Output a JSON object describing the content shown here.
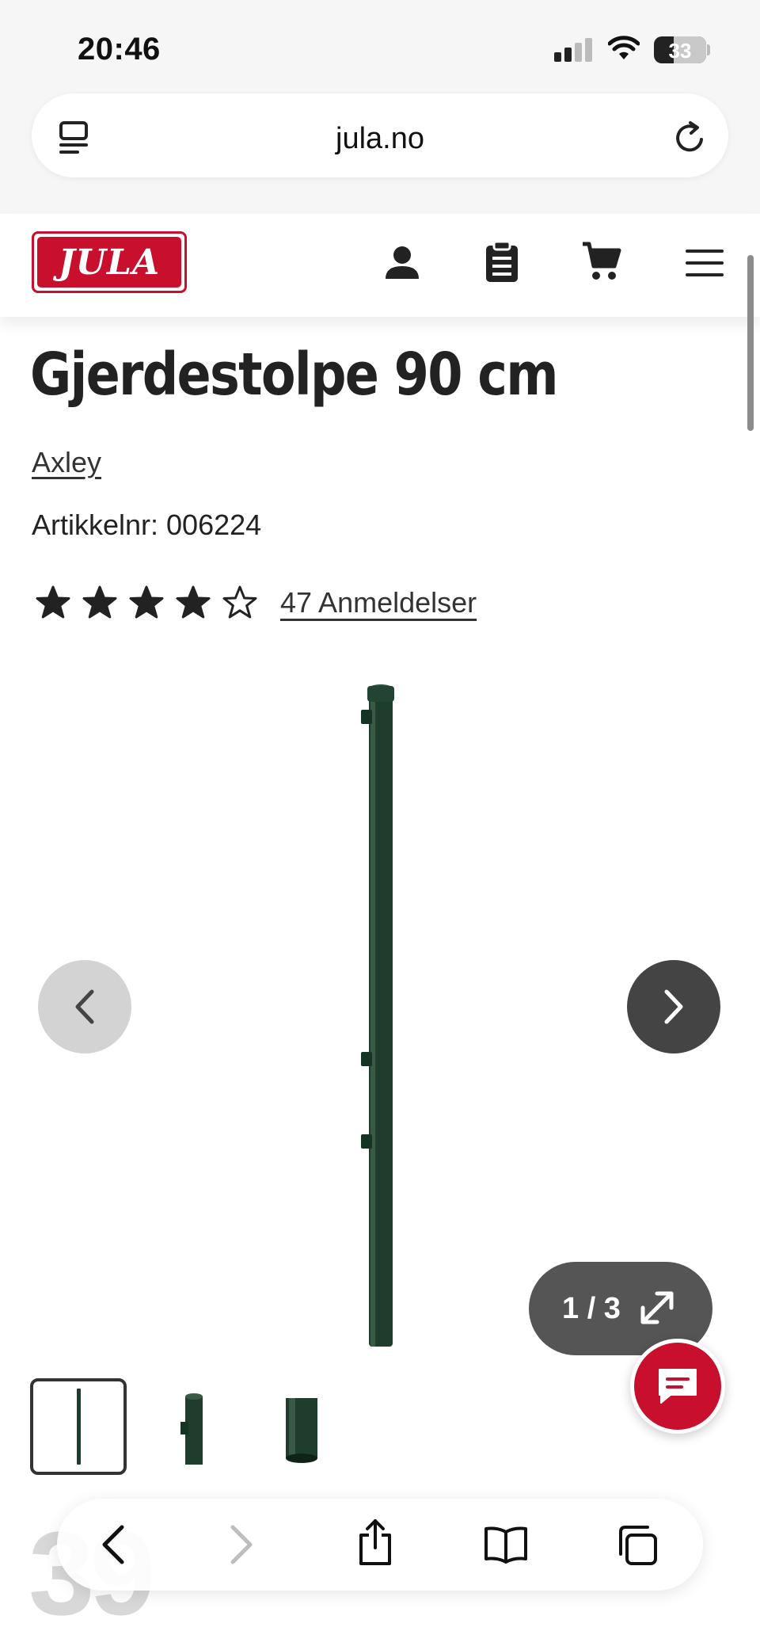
{
  "status_bar": {
    "time": "20:46",
    "battery_level": "33"
  },
  "browser": {
    "url": "jula.no"
  },
  "site": {
    "logo_text": "JULA",
    "brand_color": "#c8102e"
  },
  "product": {
    "title": "Gjerdestolpe 90 cm",
    "brand": "Axley",
    "article_number": "Artikkelnr: 006224",
    "rating": 4,
    "rating_max": 5,
    "reviews_link": "47 Anmeldelser"
  },
  "gallery": {
    "counter": "1 / 3",
    "image_count": 3,
    "current_index": 1
  },
  "ghost_price": "39",
  "icons": {
    "status": [
      "signal-icon",
      "wifi-icon",
      "battery-icon"
    ],
    "url_bar": [
      "tab-overview-icon",
      "reload-icon"
    ],
    "header": [
      "account-icon",
      "shopping-list-icon",
      "cart-icon",
      "menu-icon"
    ],
    "gallery": [
      "chevron-left-icon",
      "chevron-right-icon",
      "expand-icon",
      "chat-icon"
    ],
    "toolbar": [
      "back-icon",
      "forward-icon",
      "share-icon",
      "bookmarks-icon",
      "tabs-icon"
    ]
  }
}
